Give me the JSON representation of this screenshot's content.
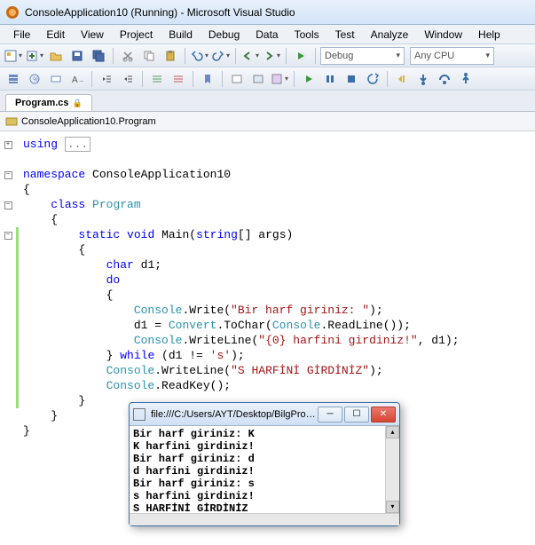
{
  "window": {
    "title": "ConsoleApplication10 (Running) - Microsoft Visual Studio"
  },
  "menu": [
    "File",
    "Edit",
    "View",
    "Project",
    "Build",
    "Debug",
    "Data",
    "Tools",
    "Test",
    "Analyze",
    "Window",
    "Help"
  ],
  "toolbar1": {
    "config": "Debug",
    "platform": "Any CPU"
  },
  "tab": {
    "filename": "Program.cs",
    "locked": true
  },
  "class_nav": "ConsoleApplication10.Program",
  "code": {
    "using_label": "using",
    "ellipsis": "...",
    "namespace_kw": "namespace",
    "namespace_name": " ConsoleApplication10",
    "lbrace": "{",
    "rbrace": "}",
    "class_kw": "class",
    "class_name": "Program",
    "static_kw": "static",
    "void_kw": "void",
    "main_name": " Main(",
    "string_kw": "string",
    "main_params": "[] args)",
    "char_kw": "char",
    "char_decl": " d1;",
    "do_kw": "do",
    "console_cls": "Console",
    "write_m": ".Write(",
    "str1": "\"Bir harf giriniz: \"",
    "close_stmt": ");",
    "assign_pre": "d1 = ",
    "convert_cls": "Convert",
    "tochar_m": ".ToChar(",
    "readline_m": ".ReadLine());",
    "writeline_m": ".WriteLine(",
    "str2": "\"{0} harfini girdiniz!\"",
    "wl_tail": ", d1);",
    "while_pre": "} ",
    "while_kw": "while",
    "while_cond": " (d1 != ",
    "chr_s": "'s'",
    "while_end": ");",
    "str3": "\"S HARFİNİ GİRDİNİZ\"",
    "readkey_m": ".ReadKey();"
  },
  "console": {
    "title": "file:///C:/Users/AYT/Desktop/BilgProg/Co...",
    "lines": "Bir harf giriniz: K\nK harfini girdiniz!\nBir harf giriniz: d\nd harfini girdiniz!\nBir harf giriniz: s\ns harfini girdiniz!\nS HARFİNİ GİRDİNİZ\n_"
  }
}
